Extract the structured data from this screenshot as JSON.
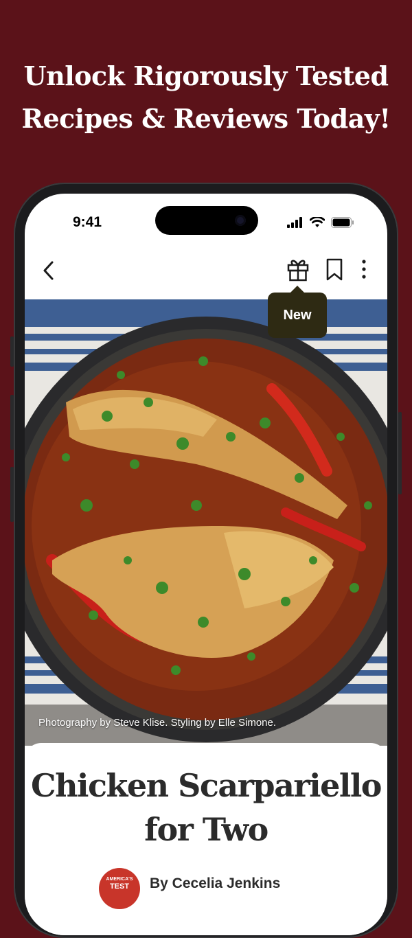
{
  "headline": {
    "line1": "Unlock Rigorously Tested",
    "line2": "Recipes & Reviews Today!"
  },
  "status_bar": {
    "time": "9:41",
    "icons": [
      "signal-icon",
      "wifi-icon",
      "battery-icon"
    ]
  },
  "nav": {
    "icons": [
      "back-chevron-icon",
      "gift-icon",
      "bookmark-icon",
      "more-vertical-icon"
    ]
  },
  "tooltip": {
    "label": "New"
  },
  "photo": {
    "credit": "Photography by Steve Klise. Styling by Elle Simone."
  },
  "recipe": {
    "title_line1": "Chicken Scarpariello",
    "title_line2": "for Two",
    "author": "By Cecelia Jenkins",
    "logo_text_small": "AMERICA'S",
    "logo_text_big": "TEST"
  },
  "colors": {
    "background": "#5b1219",
    "tooltip": "#2e2a13",
    "logo": "#c8352a"
  }
}
